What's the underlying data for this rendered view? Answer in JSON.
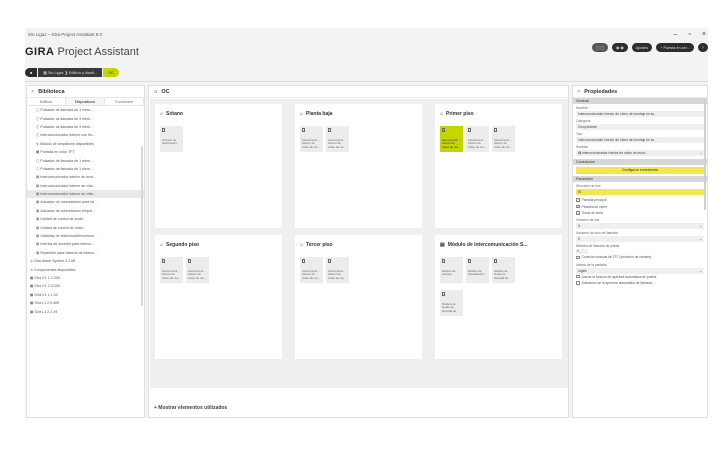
{
  "window": {
    "title": "Sin Ligaz – Gira Project Assistant 5.0",
    "controls": [
      "–",
      "▫",
      "×"
    ]
  },
  "brand": {
    "bold": "GIRA",
    "rest": " Project Assistant"
  },
  "toolbar": {
    "btn1": "▢ ▢",
    "btn2": "◉ ◉",
    "btn3": "Ajustes",
    "btn4": "◔ Puesta en ser...",
    "btn5": "?"
  },
  "breadcrumb": {
    "home": "■",
    "project": "▦ Sin Ligaz  ❯  Edificio y diseñ...",
    "current": "OC"
  },
  "left_panel": {
    "title": "Biblioteca",
    "close": "×",
    "tabs": [
      "Edificio",
      "Dispositivos",
      "Funciones"
    ],
    "items": [
      "▢  Pulsador de llamada de 3 elem...",
      "▢  Pulsador de llamada de 3 elem...",
      "▢  Pulsador de llamada de 3 elem...",
      "▢  Intercomunicador interior con lec...",
      "↯  Módulo de ampliación disponibles",
      "▦  Pantalla en color TFT",
      "▢  Pulsador de llamada de 1 elem...",
      "▢  Pulsador de llamada de 1 elem...",
      "▤  Intercomunicador interior de mon...",
      "▤  Intercomunicador interior de víde...",
      "▤  Intercomunicador interior de víde...",
      "▤  Actuador de conmutación para int...",
      "▤  Actuador de conmutación empot...",
      "▤  Unidad de control de audio",
      "▤  Unidad de control de vídeo",
      "▤  Gateway de telefonía/intercomuni...",
      "▤  Interfaz de acceder para interco...",
      "▤  Repetidor para sistema de interco...",
      "◎  Gira Alarm System 3.1.08",
      "➜  Componentes disponibles",
      "▦  Gira X1 1.2.026",
      "▦  Gira X1 2.3.026",
      "▦  Gira X1 1.1.04",
      "▦  Gira L1 2.0.469",
      "▦  Gira L1 2.2.19"
    ],
    "selected_index": 10
  },
  "center": {
    "title": "OC",
    "show_used": "+  Mostrar elementos utilizados",
    "rooms": [
      {
        "title": "Sótano",
        "icon": "⌂",
        "devices": [
          {
            "label": "Armario de distribución",
            "hl": false
          }
        ]
      },
      {
        "title": "Planta baja",
        "icon": "⌂",
        "devices": [
          {
            "label": "Intercomuni... interior de vídeo de mo...",
            "hl": false
          },
          {
            "label": "Intercomuni... interior de vídeo de mo...",
            "hl": false
          }
        ]
      },
      {
        "title": "Primer piso",
        "icon": "⌂",
        "devices": [
          {
            "label": "Intercomuni... interior de vídeo de mo...",
            "hl": true
          },
          {
            "label": "Intercomuni... interior de vídeo de mo...",
            "hl": false
          },
          {
            "label": "Intercomuni... interior de vídeo de mo...",
            "hl": false
          }
        ]
      },
      {
        "title": "Segundo piso",
        "icon": "⌂",
        "devices": [
          {
            "label": "Intercomuni... interior de vídeo de mo...",
            "hl": false
          },
          {
            "label": "Intercomuni... interior de vídeo de mo...",
            "hl": false
          }
        ]
      },
      {
        "title": "Tercer piso",
        "icon": "⌂",
        "devices": [
          {
            "label": "Intercomuni... interior de vídeo de mo...",
            "hl": false
          },
          {
            "label": "Intercomuni... interior de vídeo de mo...",
            "hl": false
          }
        ]
      },
      {
        "title": "Módulo de intercomunicación S...",
        "icon": "▤",
        "devices": [
          {
            "label": "Módulo de cámara",
            "hl": false
          },
          {
            "label": "Módulo de visualización",
            "hl": false
          },
          {
            "label": "Módulo de teclas de llamada de...",
            "hl": false
          },
          {
            "label": "Módulo de teclas de llamada de...",
            "hl": false
          }
        ]
      }
    ]
  },
  "right_panel": {
    "title": "Propiedades",
    "close": "×",
    "section_general": "General",
    "nombre_label": "Nombre",
    "nombre_value": "Intercomunicador interior de vídeo de montaje en su...",
    "categoria_label": "Categoría",
    "categoria_value": "Componente",
    "tipo_label": "Tipo",
    "tipo_value": "Intercomunicador interior de vídeo de montaje en su...",
    "simbolo_label": "Símbolo",
    "simbolo_value": "▤  Intercomunicador interior de vídeo de mont...",
    "section_conexiones": "Conexiones",
    "configurar_btn": "Configurar conexiones",
    "section_parametro": "Parámetro",
    "dir_bus_label": "Dirección de bus",
    "dir_bus_value": "81",
    "checks": [
      "Pantalla principal",
      "Pestaña de cierre",
      "Tonos de tecla"
    ],
    "vol_voz_label": "Volumen de voz",
    "vol_voz_value": "5",
    "vol_tono_label": "Volumen de tono de llamada",
    "vol_tono_value": "5",
    "mel_label": "Melodía de llamada de planta",
    "mel_value": "1",
    "check_tft": "Conexión manual de TFT (conexión de cámara)",
    "idioma_label": "Idioma de la pantalla",
    "idioma_value": "Inglés",
    "check_last1": "Activar la función de apertura automática de puerta",
    "check_last2": "Activación de la apertura automática de llamada..."
  }
}
